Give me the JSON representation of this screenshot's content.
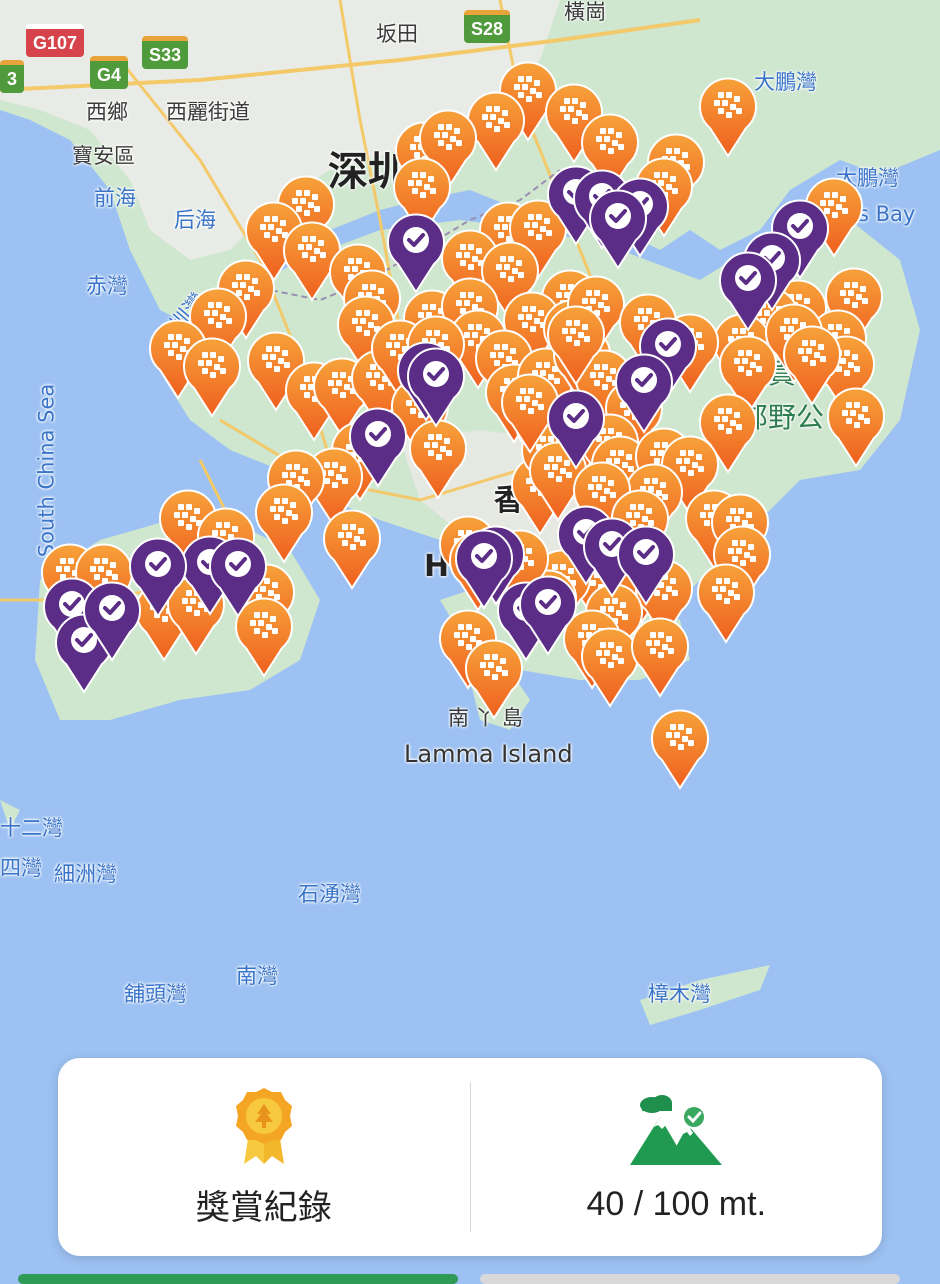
{
  "map": {
    "labels": [
      {
        "text": "橫崗",
        "cls": "dark"
      },
      {
        "text": "坂田",
        "cls": "dark"
      },
      {
        "text": "西鄉",
        "cls": "dark"
      },
      {
        "text": "西麗街道",
        "cls": "dark"
      },
      {
        "text": "寶安區",
        "cls": "dark"
      },
      {
        "text": "前海",
        "cls": "water"
      },
      {
        "text": "后海",
        "cls": "water"
      },
      {
        "text": "赤灣",
        "cls": "water"
      },
      {
        "text": "深圳灣",
        "cls": "water"
      },
      {
        "text": "深圳",
        "cls": "big"
      },
      {
        "text": "大鵬灣",
        "cls": "water"
      },
      {
        "text": "大鵬灣",
        "cls": "water"
      },
      {
        "text": "s Bay",
        "cls": "water"
      },
      {
        "text": "South China Sea",
        "cls": "water"
      },
      {
        "text": "香",
        "cls": "medium"
      },
      {
        "text": "H",
        "cls": "medium"
      },
      {
        "text": "南丫島",
        "cls": "dark"
      },
      {
        "text": "Lamma Island",
        "cls": "en"
      },
      {
        "text": "十二灣",
        "cls": "water"
      },
      {
        "text": "細洲灣",
        "cls": "water"
      },
      {
        "text": "四灣",
        "cls": "water"
      },
      {
        "text": "石湧灣",
        "cls": "water"
      },
      {
        "text": "南灣",
        "cls": "water"
      },
      {
        "text": "舖頭灣",
        "cls": "water"
      },
      {
        "text": "樟木灣",
        "cls": "water"
      },
      {
        "text": "西貢",
        "cls": "green"
      },
      {
        "text": "郊野公",
        "cls": "green"
      }
    ],
    "roads": [
      {
        "text": "G107",
        "color": "red"
      },
      {
        "text": "S28",
        "color": "green"
      },
      {
        "text": "S33",
        "color": "green"
      },
      {
        "text": "G4",
        "color": "green"
      },
      {
        "text": "3",
        "color": "green"
      }
    ],
    "colors": {
      "sea": "#9cc1f2",
      "land": "#cfe6cf",
      "urban": "#e9ece6",
      "marker_orange_top": "#f7a23a",
      "marker_orange_bottom": "#ef5f1f",
      "marker_purple": "#5b2d86"
    }
  },
  "panel": {
    "rewards_label": "獎賞紀錄",
    "rewards_icon": "award-ribbon-icon",
    "progress_icon": "mountain-check-icon",
    "progress_text": "40 / 100 mt."
  }
}
